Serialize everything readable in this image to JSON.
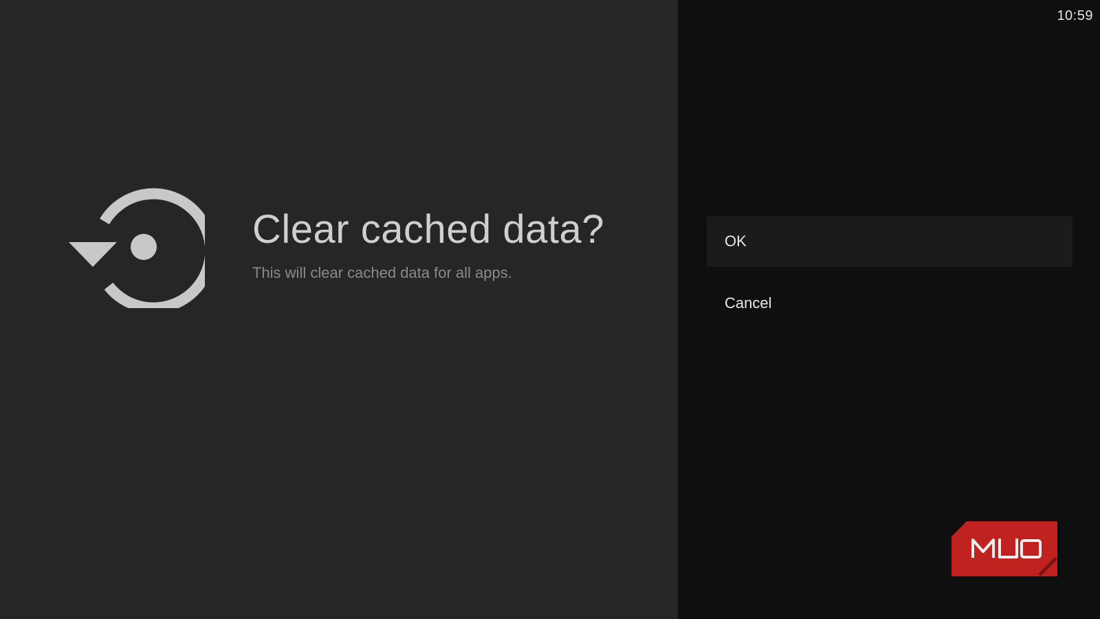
{
  "status_bar": {
    "time": "10:59"
  },
  "dialog": {
    "icon": "restore-clock-icon",
    "title": "Clear cached data?",
    "description": "This will clear cached data for all apps."
  },
  "actions": [
    {
      "label": "OK",
      "focused": true
    },
    {
      "label": "Cancel",
      "focused": false
    }
  ],
  "watermark": {
    "text": "MUO",
    "color": "#c0221f"
  },
  "colors": {
    "left_background": "#262626",
    "right_background": "#0f0f0f",
    "focused_item_background": "#1b1b1b",
    "icon_color": "#c8c8c8"
  }
}
